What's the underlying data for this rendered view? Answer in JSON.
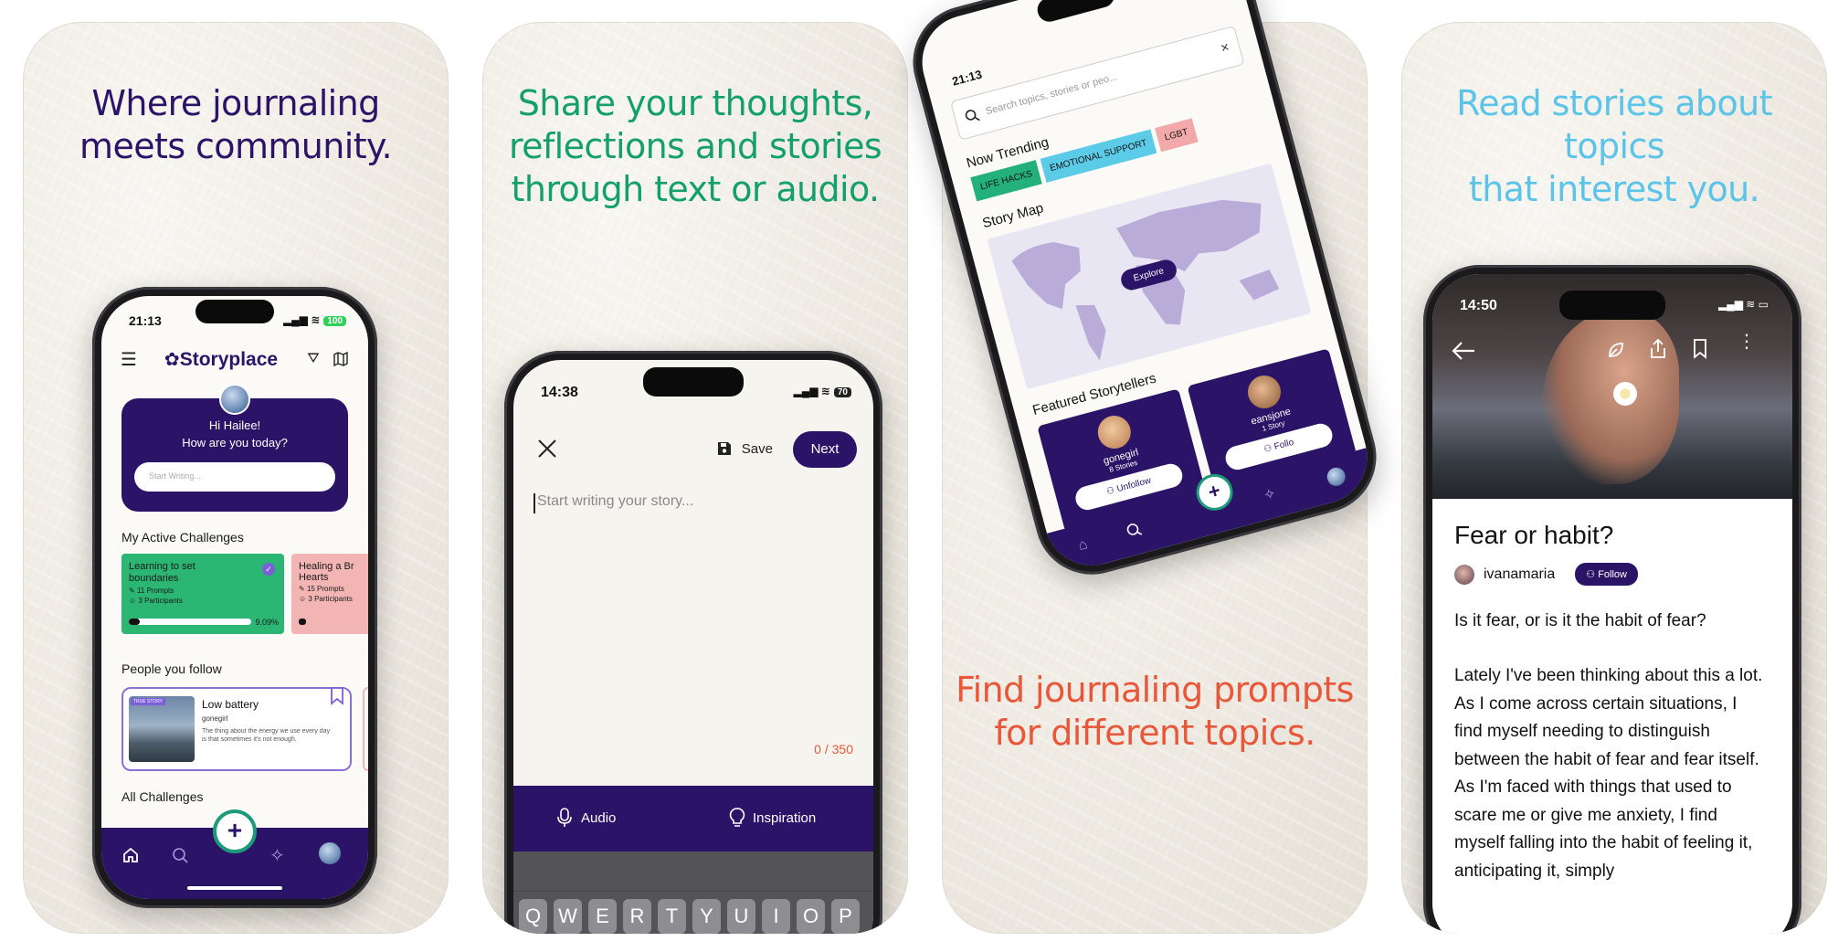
{
  "panels": [
    {
      "caption_lines": [
        "Where journaling",
        "meets community."
      ],
      "caption_color": "#2b1467"
    },
    {
      "caption_lines": [
        "Share your thoughts,",
        "reflections and stories",
        "through text or audio."
      ],
      "caption_color": "#14a06b"
    },
    {
      "caption_lines": [
        "Find journaling prompts",
        "for different topics."
      ],
      "caption_color": "#e8573a"
    },
    {
      "caption_lines": [
        "Read stories about topics",
        "that interest you."
      ],
      "caption_color": "#5bc4e8"
    }
  ],
  "phone1": {
    "time": "21:13",
    "battery": "100",
    "logo": "Storyplace",
    "greeting_line1": "Hi Hailee!",
    "greeting_line2": "How are you today?",
    "start_writing_placeholder": "Start Writing...",
    "active_challenges_title": "My Active Challenges",
    "challenges": [
      {
        "title": "Learning to set boundaries",
        "prompts": "11 Prompts",
        "participants": "3 Participants",
        "progress_label": "9.09%",
        "progress": 0.0909,
        "color": "#2bb673"
      },
      {
        "title": "Healing a Br",
        "title2": "Hearts",
        "prompts": "15 Prompts",
        "participants": "3 Participants",
        "color": "#f3b4b4"
      }
    ],
    "people_title": "People you follow",
    "follow_badge": "TRUE STORY",
    "follow_story_title": "Low battery",
    "follow_story_author": "gonegirl",
    "follow_story_excerpt": "The thing about the energy we use every day is that sometimes it's not enough.",
    "all_challenges_title": "All Challenges"
  },
  "phone2": {
    "time": "14:38",
    "battery": "70",
    "save_label": "Save",
    "next_label": "Next",
    "placeholder": "Start writing your story...",
    "counter": "0 / 350",
    "audio_label": "Audio",
    "inspiration_label": "Inspiration",
    "keys_row1": [
      "Q",
      "W",
      "E",
      "R",
      "T",
      "Y",
      "U",
      "I",
      "O",
      "P"
    ]
  },
  "phone3": {
    "time": "21:13",
    "search_placeholder": "Search topics, stories or peo...",
    "trending_title": "Now Trending",
    "tags": [
      {
        "label": "LIFE HACKS",
        "color": "#23b07a"
      },
      {
        "label": "EMOTIONAL SUPPORT",
        "color": "#5ccbe8"
      },
      {
        "label": "LGBT",
        "color": "#f3a9a9"
      }
    ],
    "map_title": "Story Map",
    "explore_label": "Explore",
    "featured_title": "Featured Storytellers",
    "storytellers": [
      {
        "name": "gonegirl",
        "stories": "8 Stories",
        "action": "Unfollow"
      },
      {
        "name": "eansjone",
        "stories": "1 Story",
        "action": "Follo"
      }
    ]
  },
  "phone4": {
    "time": "14:50",
    "story_title": "Fear or habit?",
    "author": "ivanamaria",
    "follow_label": "Follow",
    "paragraph1": "Is it fear, or is it the habit of fear?",
    "paragraph2": "Lately I've been thinking about this a lot. As I come across certain situations, I find myself needing to distinguish between the habit of fear and fear itself. As I'm faced with things that used to scare me or give me anxiety, I find myself falling into the habit of feeling it, anticipating it, simply"
  }
}
